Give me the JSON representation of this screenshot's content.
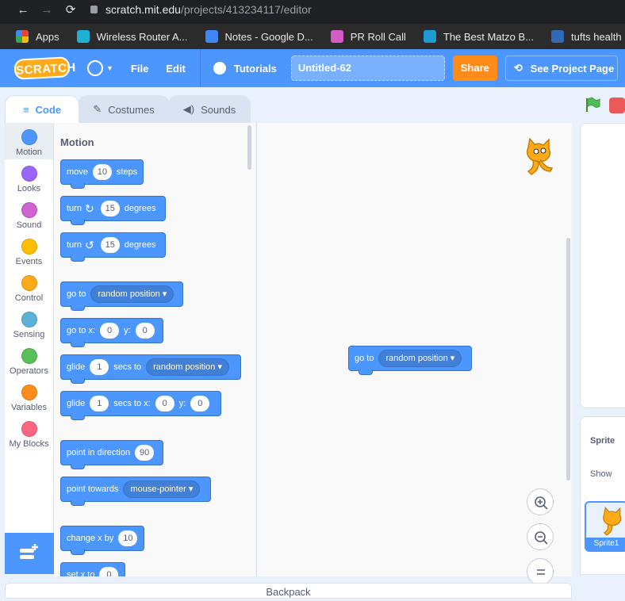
{
  "browser": {
    "back": "←",
    "forward": "→",
    "reload": "⟳",
    "url_host": "scratch.mit.edu",
    "url_path": "/projects/413234117/editor",
    "bookmarks": [
      {
        "label": "Apps",
        "color": "#ea4335"
      },
      {
        "label": "Wireless Router A...",
        "color": "#1fb0d4"
      },
      {
        "label": "Notes - Google D...",
        "color": "#4285f4"
      },
      {
        "label": "PR Roll Call",
        "color": "#d35cc7"
      },
      {
        "label": "The Best Matzo B...",
        "color": "#1f9bd4"
      },
      {
        "label": "tufts health",
        "color": "#2f6bb5"
      }
    ]
  },
  "menubar": {
    "logo": "SCRATCH",
    "file": "File",
    "edit": "Edit",
    "tutorials": "Tutorials",
    "project_title": "Untitled-62",
    "share": "Share",
    "see_project": "See Project Page"
  },
  "tabs": {
    "code": "Code",
    "costumes": "Costumes",
    "sounds": "Sounds"
  },
  "categories": [
    {
      "label": "Motion",
      "color": "#4c97ff"
    },
    {
      "label": "Looks",
      "color": "#9966ff"
    },
    {
      "label": "Sound",
      "color": "#cf63cf"
    },
    {
      "label": "Events",
      "color": "#ffbf00"
    },
    {
      "label": "Control",
      "color": "#ffab19"
    },
    {
      "label": "Sensing",
      "color": "#5cb1d6"
    },
    {
      "label": "Operators",
      "color": "#59c059"
    },
    {
      "label": "Variables",
      "color": "#ff8c1a"
    },
    {
      "label": "My Blocks",
      "color": "#ff6680"
    }
  ],
  "palette": {
    "title": "Motion",
    "move": {
      "a": "move",
      "v": "10",
      "b": "steps"
    },
    "turn_cw": {
      "a": "turn",
      "v": "15",
      "b": "degrees"
    },
    "turn_ccw": {
      "a": "turn",
      "v": "15",
      "b": "degrees"
    },
    "goto": {
      "a": "go to",
      "d": "random position"
    },
    "goto_xy": {
      "a": "go to x:",
      "x": "0",
      "b": "y:",
      "y": "0"
    },
    "glide": {
      "a": "glide",
      "v": "1",
      "b": "secs to",
      "d": "random position"
    },
    "glide_xy": {
      "a": "glide",
      "v": "1",
      "b": "secs to x:",
      "x": "0",
      "c": "y:",
      "y": "0"
    },
    "point_dir": {
      "a": "point in direction",
      "v": "90"
    },
    "point_towards": {
      "a": "point towards",
      "d": "mouse-pointer"
    },
    "change_x": {
      "a": "change x by",
      "v": "10"
    },
    "set_x": {
      "a": "set x to",
      "v": "0"
    }
  },
  "script": {
    "goto": {
      "a": "go to",
      "d": "random position"
    }
  },
  "sprite_info": {
    "sprite_label": "Sprite",
    "show_label": "Show",
    "sprite_name": "Sprite1"
  },
  "backpack": "Backpack"
}
